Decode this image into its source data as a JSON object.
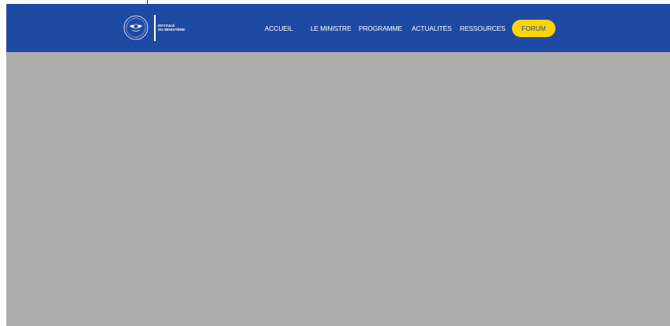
{
  "header": {
    "logo": {
      "seal_icon": "ministry-seal-icon",
      "line1": "INTITULÉ",
      "line2": "DU MINISTÈRE"
    },
    "nav": {
      "items": [
        {
          "label": "ACCUEIL"
        },
        {
          "label": "LE MINISTRE"
        },
        {
          "label": "PROGRAMME"
        },
        {
          "label": "ACTUALITÉS"
        },
        {
          "label": "RESSOURCES"
        }
      ],
      "cta": {
        "label": "FORUM"
      }
    }
  },
  "colors": {
    "header_bg": "#1f4aa3",
    "nav_text": "#ffffff",
    "cta_bg": "#ffd400",
    "cta_text": "#1f4aa3",
    "hero_placeholder": "#adadad"
  }
}
